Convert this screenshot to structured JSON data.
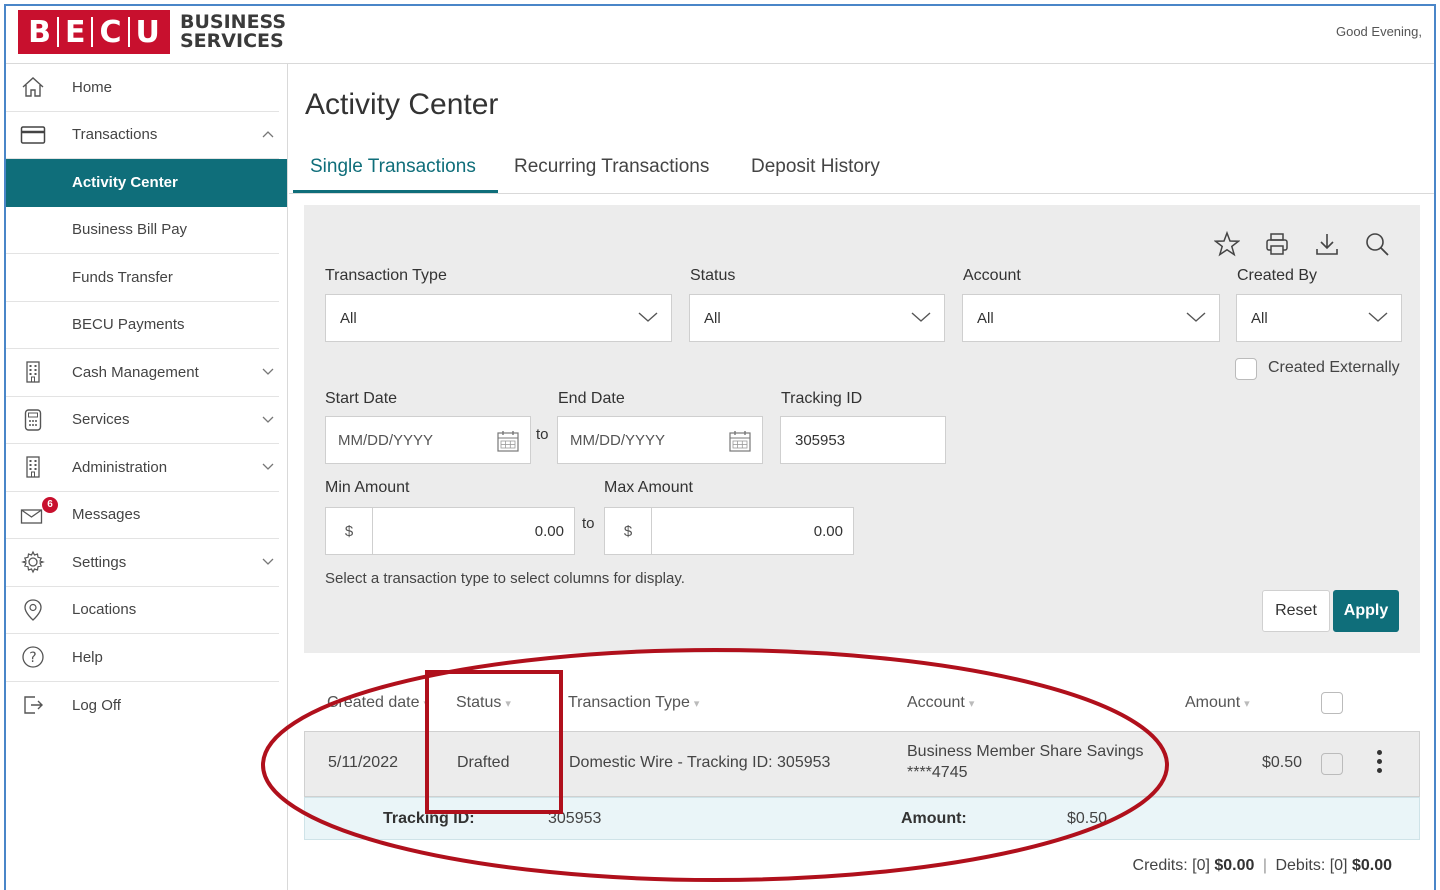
{
  "header": {
    "logo_letters": [
      "B",
      "E",
      "C",
      "U"
    ],
    "logo_text_1": "BUSINESS",
    "logo_text_2": "SERVICES",
    "greeting": "Good Evening,"
  },
  "sidebar": {
    "items": [
      {
        "label": "Home",
        "icon": "home-icon"
      },
      {
        "label": "Transactions",
        "icon": "card-icon",
        "expanded": true
      },
      {
        "label": "Activity Center",
        "active": true
      },
      {
        "label": "Business Bill Pay"
      },
      {
        "label": "Funds Transfer"
      },
      {
        "label": "BECU Payments"
      },
      {
        "label": "Cash Management",
        "icon": "building-icon"
      },
      {
        "label": "Services",
        "icon": "calculator-icon"
      },
      {
        "label": "Administration",
        "icon": "building-icon"
      },
      {
        "label": "Messages",
        "icon": "envelope-icon",
        "badge": "6"
      },
      {
        "label": "Settings",
        "icon": "gear-icon"
      },
      {
        "label": "Locations",
        "icon": "location-pin-icon"
      },
      {
        "label": "Help",
        "icon": "help-icon"
      },
      {
        "label": "Log Off",
        "icon": "logout-icon"
      }
    ]
  },
  "main": {
    "title": "Activity Center",
    "tabs": [
      {
        "label": "Single Transactions",
        "active": true
      },
      {
        "label": "Recurring Transactions"
      },
      {
        "label": "Deposit History"
      }
    ]
  },
  "filters": {
    "transaction_type": {
      "label": "Transaction Type",
      "value": "All"
    },
    "status": {
      "label": "Status",
      "value": "All"
    },
    "account": {
      "label": "Account",
      "value": "All"
    },
    "created_by": {
      "label": "Created By",
      "value": "All"
    },
    "created_externally": {
      "label": "Created Externally",
      "checked": false
    },
    "start_date": {
      "label": "Start Date",
      "placeholder": "MM/DD/YYYY"
    },
    "end_date": {
      "label": "End Date",
      "placeholder": "MM/DD/YYYY"
    },
    "to_label": "to",
    "tracking_id": {
      "label": "Tracking ID",
      "value": "305953"
    },
    "min_amount": {
      "label": "Min Amount",
      "currency": "$",
      "value": "0.00"
    },
    "max_amount": {
      "label": "Max Amount",
      "currency": "$",
      "value": "0.00"
    },
    "hint": "Select a transaction type to select columns for display.",
    "reset_label": "Reset",
    "apply_label": "Apply"
  },
  "table": {
    "columns": [
      "Created date",
      "Status",
      "Transaction Type",
      "Account",
      "Amount"
    ],
    "rows": [
      {
        "created_date": "5/11/2022",
        "status": "Drafted",
        "transaction_type": "Domestic Wire - Tracking ID: 305953",
        "account_name": "Business Member Share Savings",
        "account_number": "****4745",
        "amount": "$0.50"
      }
    ],
    "detail": {
      "tracking_label": "Tracking ID:",
      "tracking_value": "305953",
      "amount_label": "Amount:",
      "amount_value": "$0.50"
    },
    "totals": {
      "credits_label": "Credits: [0]",
      "credits_value": "$0.00",
      "separator": "|",
      "debits_label": "Debits: [0]",
      "debits_value": "$0.00"
    }
  },
  "colors": {
    "brand_red": "#c8102e",
    "teal": "#0f6e7a",
    "annotation_red": "#b0101c"
  }
}
